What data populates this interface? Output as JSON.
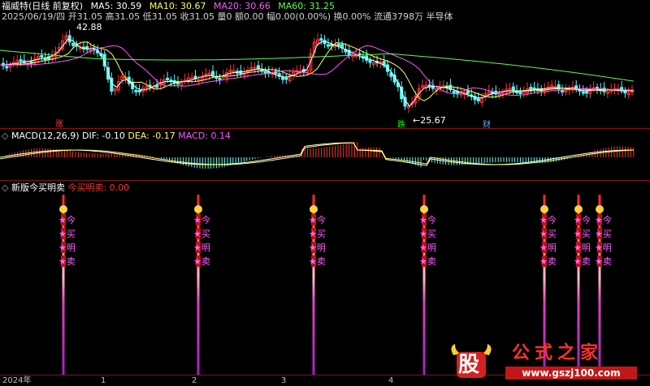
{
  "app": {
    "title": "福威特",
    "period_label": "(日线 前复权)"
  },
  "price_panel": {
    "ma_labels": [
      {
        "name": "MA5: 30.59",
        "color": "#ffffff"
      },
      {
        "name": "MA10: 30.67",
        "color": "#ffff55"
      },
      {
        "name": "MA20: 30.66",
        "color": "#ff55ff"
      },
      {
        "name": "MA60: 31.25",
        "color": "#55ff55"
      }
    ],
    "quote_line": "2025/06/19/四 开31.05 高31.05 低31.05 收31.05 量0 额0.00 幅0.00(0.00%) 换0.00% 流通3798万 半导体",
    "high_label": "42.88",
    "low_label": "←25.67",
    "markers": {
      "zhang": "涨",
      "die": "跌",
      "cai": "财"
    }
  },
  "macd_panel": {
    "title": "MACD(12,26,9)",
    "dif": "DIF: -0.10",
    "dea": "DEA: -0.17",
    "macd": "MACD: 0.14"
  },
  "signal_panel": {
    "title": "新版今买明卖",
    "value_label": "今买明卖: 0.00",
    "signal_chars": [
      "今",
      "买",
      "明",
      "卖"
    ]
  },
  "x_axis": {
    "labels": [
      "2024年",
      "1",
      "2",
      "3",
      "4"
    ]
  },
  "watermark": {
    "logo_char": "股",
    "site_name": "公式之家",
    "url": "www.gszj100.com"
  },
  "colors": {
    "bg": "#000000",
    "up": "#ff3232",
    "down": "#54ffff",
    "separator": "#8a1010"
  }
}
